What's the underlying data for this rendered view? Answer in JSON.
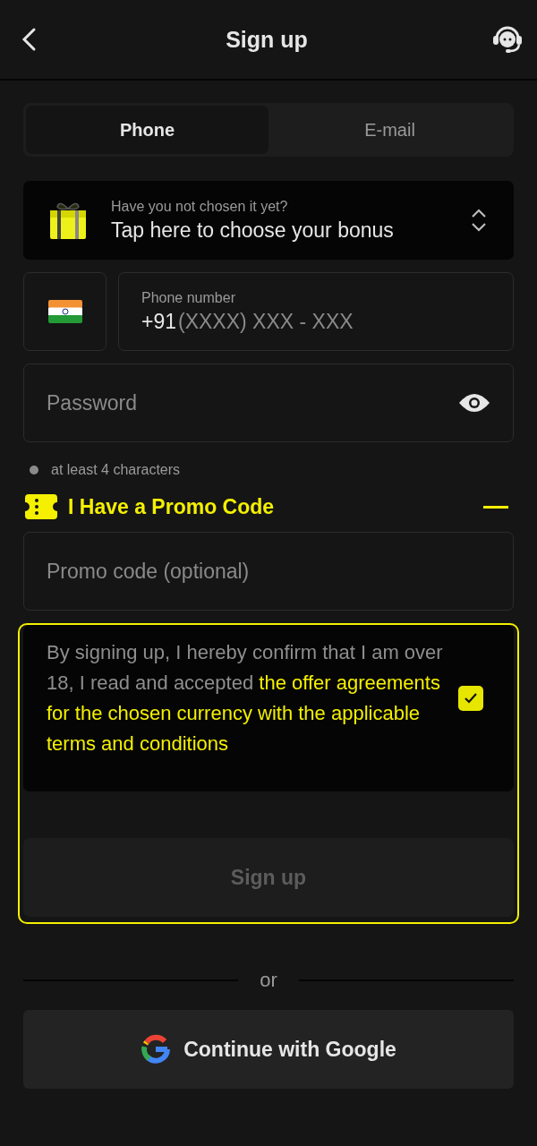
{
  "header": {
    "title": "Sign up"
  },
  "tabs": [
    {
      "label": "Phone",
      "selected": true
    },
    {
      "label": "E-mail",
      "selected": false
    }
  ],
  "bonus": {
    "hint": "Have you not chosen it yet?",
    "label": "Tap here to choose your bonus"
  },
  "phone": {
    "label": "Phone number",
    "code": "+91",
    "placeholder": "(XXXX) XXX - XXX"
  },
  "password": {
    "placeholder": "Password"
  },
  "password_rule": "at least 4 characters",
  "promo": {
    "title": "I Have a Promo Code",
    "expanded": true,
    "placeholder": "Promo code (optional)"
  },
  "consent": {
    "text": "By signing up, I hereby confirm that I am over 18, I read and accepted **the offer agreements for the chosen currency with the applicable terms and conditions**",
    "checked": true
  },
  "signup_button": {
    "label": "Sign up",
    "disabled": true
  },
  "divider": "or",
  "google_button": {
    "label": "Continue with Google"
  }
}
